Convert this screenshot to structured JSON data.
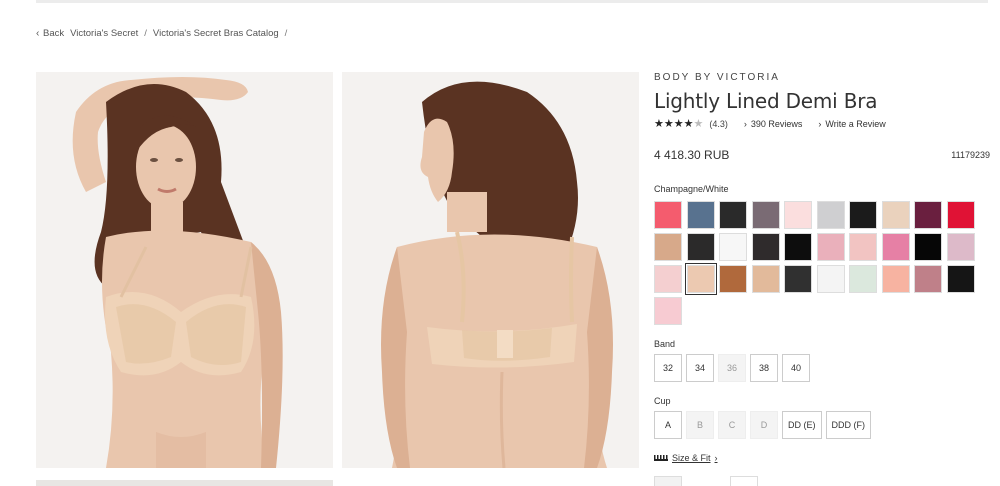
{
  "breadcrumb": {
    "back": "Back",
    "crumbs": [
      "Victoria's Secret",
      "Victoria's Secret Bras Catalog"
    ],
    "sep": "/"
  },
  "product": {
    "brand": "BODY BY VICTORIA",
    "title": "Lightly Lined Demi Bra",
    "rating": 4.3,
    "rating_text": "(4.3)",
    "stars": "★★★★",
    "half_star": "★",
    "reviews": "390 Reviews",
    "write_review": "Write a Review",
    "price": "4 418.30 RUB",
    "sku": "11179239",
    "selected_color": "Champagne/White"
  },
  "colors": {
    "primary_text": "#333333",
    "selected_outline": "#333333"
  },
  "swatches": [
    "#f45c6e",
    "#58728f",
    "#2a2a2a",
    "#7a6b74",
    "#fbdede",
    "#cfcfd1",
    "#1b1b1b",
    "#ead2bd",
    "#6a1f3f",
    "#e01235",
    "#d7a98a",
    "#2b2a2a",
    "#f7f7f7",
    "#2f2b2c",
    "#0d0d0d",
    "#eab0bb",
    "#f2c4c2",
    "#e680a5",
    "#060606",
    "#ddbac9",
    "#f4cfd0",
    "#ecc9b1",
    "#b0693c",
    "#e2ba9b",
    "#303030",
    "#f4f4f4",
    "#dbe8dd",
    "#f7b3a1",
    "#bf8089",
    "#151515",
    "#f7cbd2"
  ],
  "selected_swatch_index": 21,
  "band": {
    "label": "Band",
    "options": [
      {
        "label": "32",
        "disabled": false
      },
      {
        "label": "34",
        "disabled": false
      },
      {
        "label": "36",
        "disabled": true
      },
      {
        "label": "38",
        "disabled": false
      },
      {
        "label": "40",
        "disabled": false
      }
    ]
  },
  "cup": {
    "label": "Cup",
    "options": [
      {
        "label": "A",
        "disabled": false
      },
      {
        "label": "B",
        "disabled": true
      },
      {
        "label": "C",
        "disabled": true
      },
      {
        "label": "D",
        "disabled": true
      },
      {
        "label": "DD (E)",
        "disabled": false
      },
      {
        "label": "DDD (F)",
        "disabled": false
      }
    ]
  },
  "size_fit": {
    "label": "Size & Fit",
    "icon": "ruler-icon"
  },
  "icons": {
    "back": "chevron-left-icon",
    "reviews": "chevron-right-icon",
    "write": "chevron-right-icon"
  }
}
